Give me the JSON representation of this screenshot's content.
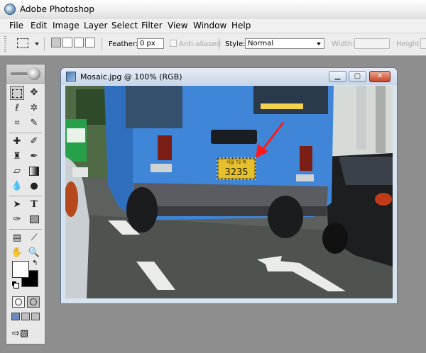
{
  "app": {
    "title": "Adobe Photoshop"
  },
  "menu": [
    "File",
    "Edit",
    "Image",
    "Layer",
    "Select",
    "Filter",
    "View",
    "Window",
    "Help"
  ],
  "options": {
    "feather_label": "Feather:",
    "feather_value": "0 px",
    "antialias_label": "Anti-aliased",
    "style_label": "Style:",
    "style_value": "Normal",
    "width_label": "Width:",
    "height_label": "Height:"
  },
  "tools": {
    "move_icon": "move-icon",
    "type_label": "T",
    "foreground_color": "#ffffff",
    "background_color": "#000000"
  },
  "document": {
    "title": "Mosaic.jpg @ 100% (RGB)",
    "plate_text": "3235",
    "plate_top_text": "서울 72 마",
    "arrow_color": "#ff1a1a"
  }
}
